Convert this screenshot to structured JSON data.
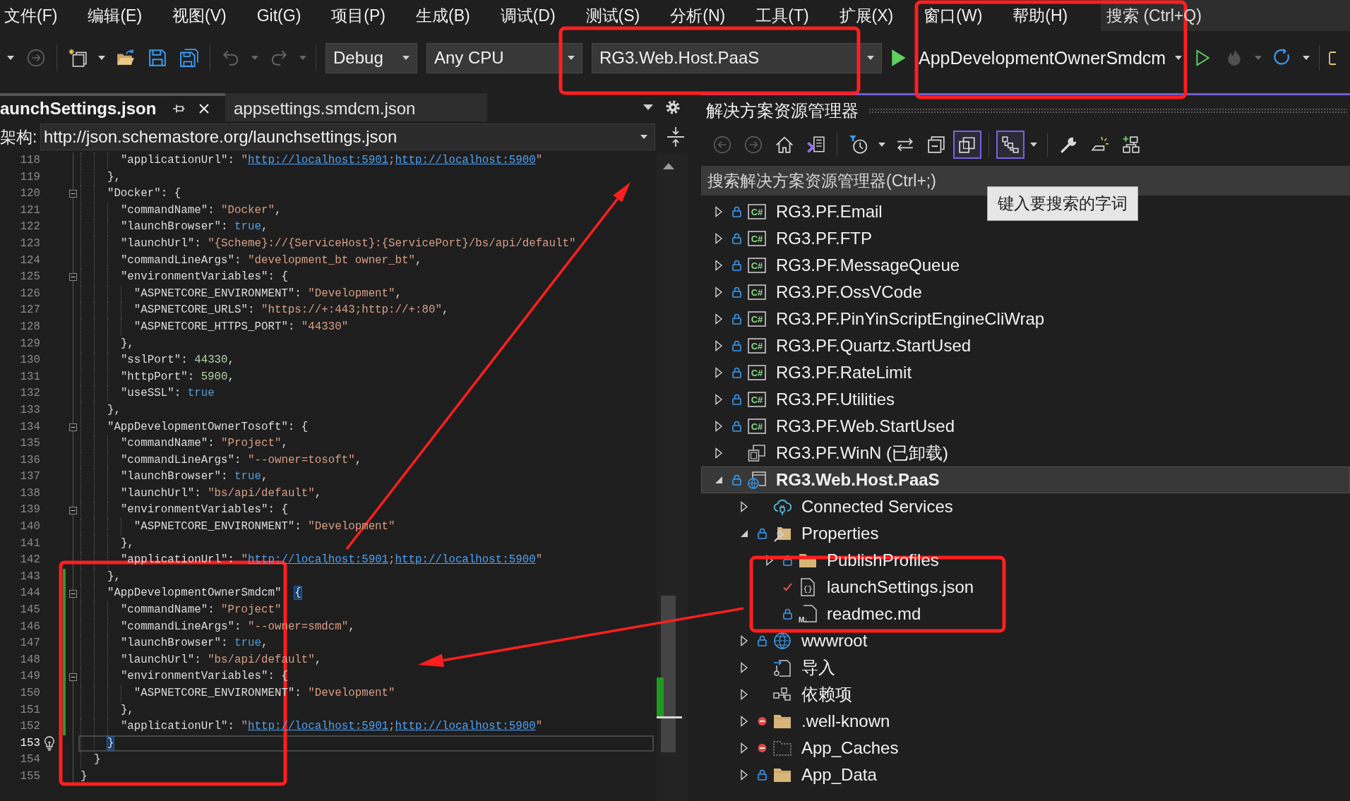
{
  "menu": {
    "items": [
      "文件(F)",
      "编辑(E)",
      "视图(V)",
      "Git(G)",
      "项目(P)",
      "生成(B)",
      "调试(D)",
      "测试(S)",
      "分析(N)",
      "工具(T)",
      "扩展(X)",
      "窗口(W)",
      "帮助(H)"
    ],
    "search": {
      "placeholder": "搜索 (Ctrl+Q)"
    }
  },
  "toolbar": {
    "items": [
      {
        "kind": "overflow"
      },
      {
        "kind": "forward",
        "disabled": true
      },
      {
        "kind": "separator"
      },
      {
        "kind": "newitem",
        "dropdown": true
      },
      {
        "kind": "open"
      },
      {
        "kind": "save"
      },
      {
        "kind": "saveall"
      },
      {
        "kind": "separator"
      },
      {
        "kind": "undo",
        "disabled": true,
        "dropdown": true
      },
      {
        "kind": "redo",
        "disabled": true,
        "dropdown": true
      },
      {
        "kind": "separator"
      },
      {
        "kind": "configuration",
        "value": "Debug"
      },
      {
        "kind": "platform",
        "value": "Any CPU"
      },
      {
        "kind": "project",
        "value": "RG3.Web.Host.PaaS"
      },
      {
        "kind": "run",
        "value": "AppDevelopmentOwnerSmdcm",
        "dropdown": true
      },
      {
        "kind": "nodebug"
      },
      {
        "kind": "hotreload",
        "disabled": true,
        "dropdown": true
      },
      {
        "kind": "restart",
        "dropdown": true
      },
      {
        "kind": "separator"
      },
      {
        "kind": "window"
      }
    ]
  },
  "editor": {
    "tabs": [
      {
        "label": "aunchSettings.json",
        "selected": true
      },
      {
        "label": "appsettings.smdcm.json",
        "selected": false
      }
    ],
    "schema": {
      "label": "架构:",
      "value": "http://json.schemastore.org/launchsettings.json"
    },
    "lines": [
      {
        "number": "118",
        "tokens": [
          {
            "kind": "key",
            "text": "      \"applicationUrl\""
          },
          {
            "kind": "punct",
            "text": ": "
          },
          {
            "kind": "string",
            "text": "\""
          },
          {
            "kind": "link",
            "text": "http://localhost:5901"
          },
          {
            "kind": "string",
            "text": ";"
          },
          {
            "kind": "link",
            "text": "http://localhost:5900"
          },
          {
            "kind": "string",
            "text": "\""
          }
        ]
      },
      {
        "number": "119",
        "tokens": [
          {
            "kind": "punct",
            "text": "    },"
          }
        ]
      },
      {
        "number": "120",
        "fold_open": true,
        "tokens": [
          {
            "kind": "key",
            "text": "    \"Docker\""
          },
          {
            "kind": "punct",
            "text": ": {"
          }
        ]
      },
      {
        "number": "121",
        "tokens": [
          {
            "kind": "key",
            "text": "      \"commandName\""
          },
          {
            "kind": "punct",
            "text": ": "
          },
          {
            "kind": "string",
            "text": "\"Docker\""
          },
          {
            "kind": "punct",
            "text": ","
          }
        ]
      },
      {
        "number": "122",
        "tokens": [
          {
            "kind": "key",
            "text": "      \"launchBrowser\""
          },
          {
            "kind": "punct",
            "text": ": "
          },
          {
            "kind": "literal",
            "text": "true"
          },
          {
            "kind": "punct",
            "text": ","
          }
        ]
      },
      {
        "number": "123",
        "tokens": [
          {
            "kind": "key",
            "text": "      \"launchUrl\""
          },
          {
            "kind": "punct",
            "text": ": "
          },
          {
            "kind": "string",
            "text": "\"{Scheme}://{ServiceHost}:{ServicePort}/bs/api/default\""
          }
        ]
      },
      {
        "number": "124",
        "tokens": [
          {
            "kind": "key",
            "text": "      \"commandLineArgs\""
          },
          {
            "kind": "punct",
            "text": ": "
          },
          {
            "kind": "string",
            "text": "\"development_bt owner_bt\""
          },
          {
            "kind": "punct",
            "text": ","
          }
        ]
      },
      {
        "number": "125",
        "fold_open": true,
        "tokens": [
          {
            "kind": "key",
            "text": "      \"environmentVariables\""
          },
          {
            "kind": "punct",
            "text": ": {"
          }
        ]
      },
      {
        "number": "126",
        "tokens": [
          {
            "kind": "key",
            "text": "        \"ASPNETCORE_ENVIRONMENT\""
          },
          {
            "kind": "punct",
            "text": ": "
          },
          {
            "kind": "string",
            "text": "\"Development\""
          },
          {
            "kind": "punct",
            "text": ","
          }
        ]
      },
      {
        "number": "127",
        "tokens": [
          {
            "kind": "key",
            "text": "        \"ASPNETCORE_URLS\""
          },
          {
            "kind": "punct",
            "text": ": "
          },
          {
            "kind": "string",
            "text": "\"https://+:443;http://+:80\""
          },
          {
            "kind": "punct",
            "text": ","
          }
        ]
      },
      {
        "number": "128",
        "tokens": [
          {
            "kind": "key",
            "text": "        \"ASPNETCORE_HTTPS_PORT\""
          },
          {
            "kind": "punct",
            "text": ": "
          },
          {
            "kind": "string",
            "text": "\"44330\""
          }
        ]
      },
      {
        "number": "129",
        "tokens": [
          {
            "kind": "punct",
            "text": "      },"
          }
        ]
      },
      {
        "number": "130",
        "tokens": [
          {
            "kind": "key",
            "text": "      \"sslPort\""
          },
          {
            "kind": "punct",
            "text": ": "
          },
          {
            "kind": "number",
            "text": "44330"
          },
          {
            "kind": "punct",
            "text": ","
          }
        ]
      },
      {
        "number": "131",
        "tokens": [
          {
            "kind": "key",
            "text": "      \"httpPort\""
          },
          {
            "kind": "punct",
            "text": ": "
          },
          {
            "kind": "number",
            "text": "5900"
          },
          {
            "kind": "punct",
            "text": ","
          }
        ]
      },
      {
        "number": "132",
        "tokens": [
          {
            "kind": "key",
            "text": "      \"useSSL\""
          },
          {
            "kind": "punct",
            "text": ": "
          },
          {
            "kind": "literal",
            "text": "true"
          }
        ]
      },
      {
        "number": "133",
        "tokens": [
          {
            "kind": "punct",
            "text": "    },"
          }
        ]
      },
      {
        "number": "134",
        "fold_open": true,
        "tokens": [
          {
            "kind": "key",
            "text": "    \"AppDevelopmentOwnerTosoft\""
          },
          {
            "kind": "punct",
            "text": ": {"
          }
        ]
      },
      {
        "number": "135",
        "tokens": [
          {
            "kind": "key",
            "text": "      \"commandName\""
          },
          {
            "kind": "punct",
            "text": ": "
          },
          {
            "kind": "string",
            "text": "\"Project\""
          },
          {
            "kind": "punct",
            "text": ","
          }
        ]
      },
      {
        "number": "136",
        "tokens": [
          {
            "kind": "key",
            "text": "      \"commandLineArgs\""
          },
          {
            "kind": "punct",
            "text": ": "
          },
          {
            "kind": "string",
            "text": "\"--owner=tosoft\""
          },
          {
            "kind": "punct",
            "text": ","
          }
        ]
      },
      {
        "number": "137",
        "tokens": [
          {
            "kind": "key",
            "text": "      \"launchBrowser\""
          },
          {
            "kind": "punct",
            "text": ": "
          },
          {
            "kind": "literal",
            "text": "true"
          },
          {
            "kind": "punct",
            "text": ","
          }
        ]
      },
      {
        "number": "138",
        "tokens": [
          {
            "kind": "key",
            "text": "      \"launchUrl\""
          },
          {
            "kind": "punct",
            "text": ": "
          },
          {
            "kind": "string",
            "text": "\"bs/api/default\""
          },
          {
            "kind": "punct",
            "text": ","
          }
        ]
      },
      {
        "number": "139",
        "fold_open": true,
        "tokens": [
          {
            "kind": "key",
            "text": "      \"environmentVariables\""
          },
          {
            "kind": "punct",
            "text": ": {"
          }
        ]
      },
      {
        "number": "140",
        "tokens": [
          {
            "kind": "key",
            "text": "        \"ASPNETCORE_ENVIRONMENT\""
          },
          {
            "kind": "punct",
            "text": ": "
          },
          {
            "kind": "string",
            "text": "\"Development\""
          }
        ]
      },
      {
        "number": "141",
        "tokens": [
          {
            "kind": "punct",
            "text": "      },"
          }
        ]
      },
      {
        "number": "142",
        "tokens": [
          {
            "kind": "key",
            "text": "      \"applicationUrl\""
          },
          {
            "kind": "punct",
            "text": ": "
          },
          {
            "kind": "string",
            "text": "\""
          },
          {
            "kind": "link",
            "text": "http://localhost:5901"
          },
          {
            "kind": "string",
            "text": ";"
          },
          {
            "kind": "link",
            "text": "http://localhost:5900"
          },
          {
            "kind": "string",
            "text": "\""
          }
        ]
      },
      {
        "number": "143",
        "changed": true,
        "tokens": [
          {
            "kind": "punct",
            "text": "    },"
          }
        ]
      },
      {
        "number": "144",
        "changed": true,
        "fold_open": true,
        "tokens": [
          {
            "kind": "key",
            "text": "    \"AppDevelopmentOwnerSmdcm\"  "
          },
          {
            "kind": "punct",
            "text": "{",
            "match": true
          }
        ]
      },
      {
        "number": "145",
        "changed": true,
        "tokens": [
          {
            "kind": "key",
            "text": "      \"commandName\""
          },
          {
            "kind": "punct",
            "text": ": "
          },
          {
            "kind": "string",
            "text": "\"Project\""
          }
        ]
      },
      {
        "number": "146",
        "changed": true,
        "tokens": [
          {
            "kind": "key",
            "text": "      \"commandLineArgs\""
          },
          {
            "kind": "punct",
            "text": ": "
          },
          {
            "kind": "string",
            "text": "\"--owner=smdcm\""
          },
          {
            "kind": "punct",
            "text": ","
          }
        ]
      },
      {
        "number": "147",
        "changed": true,
        "tokens": [
          {
            "kind": "key",
            "text": "      \"launchBrowser\""
          },
          {
            "kind": "punct",
            "text": ": "
          },
          {
            "kind": "literal",
            "text": "true"
          },
          {
            "kind": "punct",
            "text": ","
          }
        ]
      },
      {
        "number": "148",
        "changed": true,
        "tokens": [
          {
            "kind": "key",
            "text": "      \"launchUrl\""
          },
          {
            "kind": "punct",
            "text": ": "
          },
          {
            "kind": "string",
            "text": "\"bs/api/default\""
          },
          {
            "kind": "punct",
            "text": ","
          }
        ]
      },
      {
        "number": "149",
        "changed": true,
        "fold_open": true,
        "tokens": [
          {
            "kind": "key",
            "text": "      \"environmentVariables\""
          },
          {
            "kind": "punct",
            "text": ": {"
          }
        ]
      },
      {
        "number": "150",
        "changed": true,
        "tokens": [
          {
            "kind": "key",
            "text": "        \"ASPNETCORE_ENVIRONMENT\""
          },
          {
            "kind": "punct",
            "text": ": "
          },
          {
            "kind": "string",
            "text": "\"Development\""
          }
        ]
      },
      {
        "number": "151",
        "changed": true,
        "tokens": [
          {
            "kind": "punct",
            "text": "      },"
          }
        ]
      },
      {
        "number": "152",
        "changed": true,
        "tokens": [
          {
            "kind": "key",
            "text": "      \"applicationUrl\""
          },
          {
            "kind": "punct",
            "text": ": "
          },
          {
            "kind": "string",
            "text": "\""
          },
          {
            "kind": "link",
            "text": "http://localhost:5901"
          },
          {
            "kind": "string",
            "text": ";"
          },
          {
            "kind": "link",
            "text": "http://localhost:5900"
          },
          {
            "kind": "string",
            "text": "\""
          }
        ]
      },
      {
        "number": "153",
        "current": true,
        "lightbulb": true,
        "tokens": [
          {
            "kind": "punct",
            "text": "    }",
            "match": true
          }
        ]
      },
      {
        "number": "154",
        "tokens": [
          {
            "kind": "punct",
            "text": "  }"
          }
        ]
      },
      {
        "number": "155",
        "tokens": [
          {
            "kind": "punct",
            "text": "}"
          }
        ]
      }
    ]
  },
  "solution_explorer": {
    "title": "解决方案资源管理器",
    "toolbar": [
      {
        "kind": "back",
        "disabled": true
      },
      {
        "kind": "forward",
        "disabled": true
      },
      {
        "kind": "home"
      },
      {
        "kind": "views"
      },
      {
        "kind": "separator"
      },
      {
        "kind": "filter",
        "dropdown": true
      },
      {
        "kind": "sync"
      },
      {
        "kind": "collapse"
      },
      {
        "kind": "showall",
        "pressed": true
      },
      {
        "kind": "separator"
      },
      {
        "kind": "hierarchy",
        "pressed": true,
        "dropdown": true
      },
      {
        "kind": "separator"
      },
      {
        "kind": "properties"
      },
      {
        "kind": "preview"
      },
      {
        "kind": "addstructure"
      }
    ],
    "search": {
      "placeholder": "搜索解决方案资源管理器(Ctrl+;)"
    },
    "tooltip": "键入要搜索的字词",
    "tree": [
      {
        "label": "RG3.PF.Email",
        "kind": "csharp",
        "icon_label": "C#",
        "locked": true,
        "expanded": false,
        "selected": false
      },
      {
        "label": "RG3.PF.FTP",
        "kind": "csharp",
        "icon_label": "C#",
        "locked": true,
        "expanded": false,
        "selected": false
      },
      {
        "label": "RG3.PF.MessageQueue",
        "kind": "csharp",
        "icon_label": "C#",
        "locked": true,
        "expanded": false,
        "selected": false
      },
      {
        "label": "RG3.PF.OssVCode",
        "kind": "csharp",
        "icon_label": "C#",
        "locked": true,
        "expanded": false,
        "selected": false
      },
      {
        "label": "RG3.PF.PinYinScriptEngineCliWrap",
        "kind": "csharp",
        "icon_label": "C#",
        "locked": true,
        "expanded": false,
        "selected": false
      },
      {
        "label": "RG3.PF.Quartz.StartUsed",
        "kind": "csharp",
        "icon_label": "C#",
        "locked": true,
        "expanded": false,
        "selected": false
      },
      {
        "label": "RG3.PF.RateLimit",
        "kind": "csharp",
        "icon_label": "C#",
        "locked": true,
        "expanded": false,
        "selected": false
      },
      {
        "label": "RG3.PF.Utilities",
        "kind": "csharp",
        "icon_label": "C#",
        "locked": true,
        "expanded": false,
        "selected": false
      },
      {
        "label": "RG3.PF.Web.StartUsed",
        "kind": "csharp",
        "icon_label": "C#",
        "locked": true,
        "expanded": false,
        "selected": false
      },
      {
        "label": "RG3.PF.WinN (已卸载)",
        "kind": "unloaded",
        "expanded": false,
        "selected": false
      },
      {
        "label": "RG3.Web.Host.PaaS",
        "kind": "webproject",
        "locked": true,
        "expanded": true,
        "selected": true,
        "startup": true,
        "children": [
          {
            "label": "Connected Services",
            "kind": "services",
            "expanded": false,
            "selected": false
          },
          {
            "label": "Properties",
            "kind": "properties",
            "locked": true,
            "expanded": true,
            "selected": false,
            "children": [
              {
                "label": "PublishProfiles",
                "kind": "folder",
                "locked": true,
                "expanded": false,
                "selected": false
              },
              {
                "label": "launchSettings.json",
                "kind": "json",
                "icon_label": "{}",
                "checked_out": true,
                "selected": false
              },
              {
                "label": "readmec.md",
                "kind": "markdown",
                "icon_label": "M↓",
                "locked": true,
                "selected": false
              }
            ]
          },
          {
            "label": "wwwroot",
            "kind": "globe",
            "locked": true,
            "expanded": false,
            "selected": false
          },
          {
            "label": "导入",
            "kind": "imports",
            "expanded": false,
            "selected": false
          },
          {
            "label": "依赖项",
            "kind": "dependencies",
            "expanded": false,
            "selected": false
          },
          {
            "label": ".well-known",
            "kind": "folder",
            "excluded": true,
            "expanded": false,
            "selected": false
          },
          {
            "label": "App_Caches",
            "kind": "hidden",
            "excluded": true,
            "expanded": false,
            "selected": false
          },
          {
            "label": "App_Data",
            "kind": "folder",
            "locked": true,
            "expanded": false,
            "selected": false
          }
        ]
      }
    ]
  }
}
